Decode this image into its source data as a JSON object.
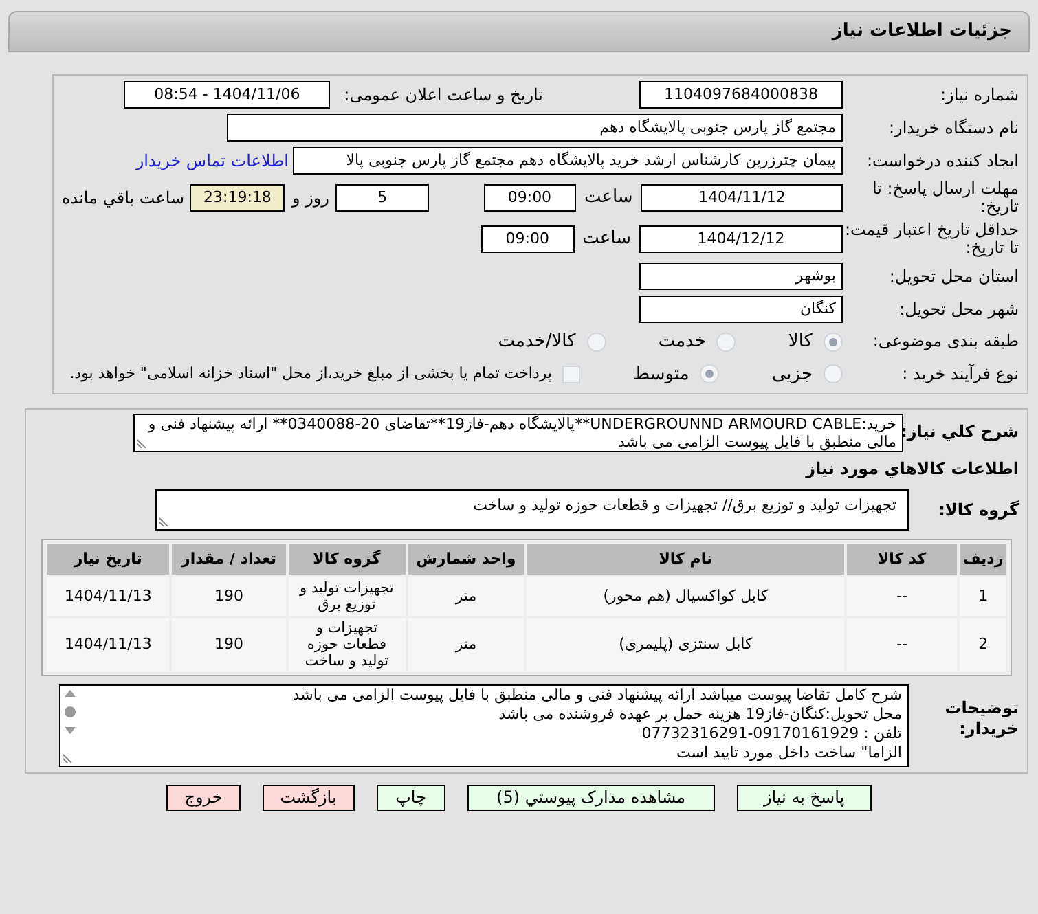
{
  "header": {
    "title": "جزئیات اطلاعات نیاز"
  },
  "details": {
    "need_number": {
      "label": "شماره نیاز:",
      "value": "1104097684000838"
    },
    "announce": {
      "label": "تاریخ و ساعت اعلان عمومی:",
      "value": "1404/11/06 - 08:54"
    },
    "buyer": {
      "label": "نام دستگاه خریدار:",
      "value": "مجتمع گاز پارس جنوبی  پالایشگاه دهم"
    },
    "creator": {
      "label": "ایجاد کننده درخواست:",
      "value": "پیمان چترزرین کارشناس ارشد خرید پالایشگاه دهم مجتمع گاز پارس جنوبی  پالا",
      "link": "اطلاعات تماس خریدار"
    },
    "reply_deadline": {
      "label": "مهلت ارسال پاسخ: تا تاریخ:",
      "date": "1404/11/12",
      "time_label": "ساعت",
      "time": "09:00",
      "days": "5",
      "days_label": "روز و",
      "remaining": "23:19:18",
      "remaining_label": "ساعت باقي مانده"
    },
    "validity": {
      "label": "حداقل تاریخ اعتبار قیمت: تا تاریخ:",
      "date": "1404/12/12",
      "time_label": "ساعت",
      "time": "09:00"
    },
    "province": {
      "label": "استان محل تحویل:",
      "value": "بوشهر"
    },
    "city": {
      "label": "شهر محل تحویل:",
      "value": "کنگان"
    },
    "category": {
      "label": "طبقه بندی موضوعی:",
      "options": [
        {
          "label": "کالا",
          "selected": true
        },
        {
          "label": "خدمت",
          "selected": false
        },
        {
          "label": "کالا/خدمت",
          "selected": false
        }
      ]
    },
    "process": {
      "label": "نوع فرآیند خرید :",
      "options": [
        {
          "label": "جزیی",
          "selected": false
        },
        {
          "label": "متوسط",
          "selected": true
        }
      ],
      "treasury": {
        "checked": false,
        "label": "پرداخت تمام یا بخشی از مبلغ خرید،از محل \"اسناد خزانه اسلامی\" خواهد بود."
      }
    }
  },
  "goods": {
    "summary": {
      "label": "شرح کلي نياز:",
      "value": "خرید:UNDERGROUNND ARMOURD CABLE**پالایشگاه دهم-فاز19**تقاضای 20-0340088** ارائه پیشنهاد فنی و مالی منطبق با فایل پیوست الزامی می باشد"
    },
    "section_title": "اطلاعات کالاهاي مورد نياز",
    "group": {
      "label": "گروه کالا:",
      "value": "تجهیزات تولید و توزیع برق// تجهیزات و قطعات حوزه تولید و ساخت"
    },
    "table": {
      "columns": [
        "ردیف",
        "کد کالا",
        "نام کالا",
        "واحد شمارش",
        "گروه کالا",
        "تعداد / مقدار",
        "تاریخ نیاز"
      ],
      "rows": [
        [
          "1",
          "--",
          "کابل کواکسیال (هم محور)",
          "متر",
          "تجهیزات تولید و توزیع برق",
          "190",
          "1404/11/13"
        ],
        [
          "2",
          "--",
          "کابل سنتزی (پلیمری)",
          "متر",
          "تجهیزات و قطعات حوزه تولید و ساخت",
          "190",
          "1404/11/13"
        ]
      ]
    },
    "notes": {
      "label": "توضیحات خریدار:",
      "lines": [
        "شرح کامل تقاضا پیوست میباشد ارائه پیشنهاد فنی و مالی منطبق با فایل پیوست الزامی می باشد",
        "محل تحویل:کنگان-فاز19 هزینه حمل بر عهده فروشنده می باشد",
        "تلفن : 09170161929-07732316291",
        "الزاما\" ساخت داخل مورد تایید است"
      ]
    }
  },
  "buttons": [
    {
      "label": "پاسخ به نیاز",
      "kind": "action"
    },
    {
      "label": "مشاهده مدارک پیوستي (5)",
      "kind": "action"
    },
    {
      "label": "چاپ",
      "kind": "action"
    },
    {
      "label": "بازگشت",
      "kind": "danger"
    },
    {
      "label": "خروج",
      "kind": "danger"
    }
  ]
}
